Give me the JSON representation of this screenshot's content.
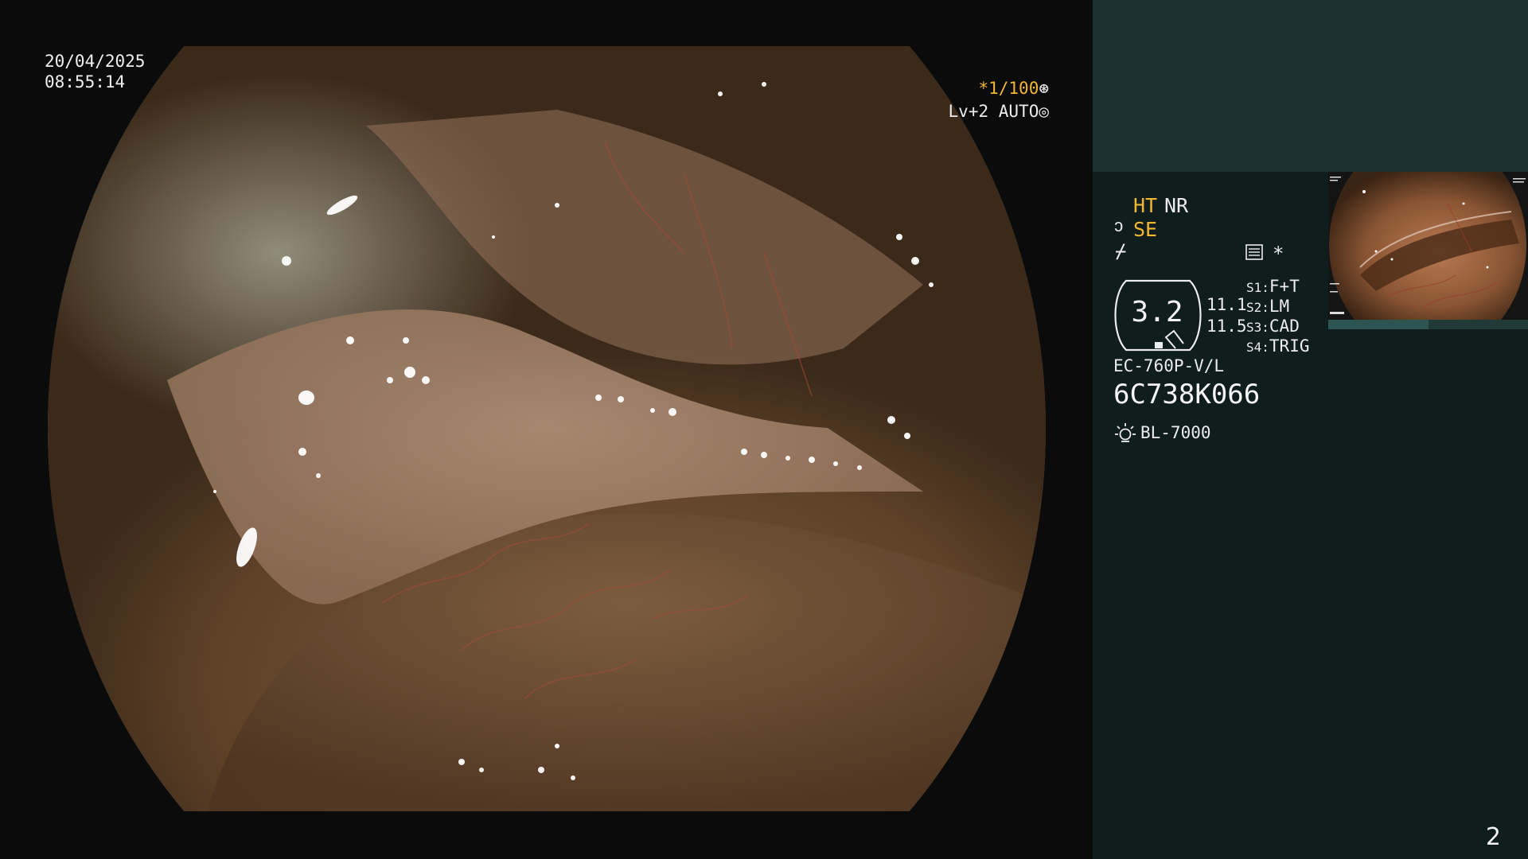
{
  "main_view": {
    "date": "20/04/2025",
    "time": "08:55:14",
    "shutter_speed": "*1/100",
    "shutter_icon": "shutter-icon",
    "enhancement_level": "Lv+2",
    "iris_mode": "AUTO",
    "iris_icon": "iris-icon"
  },
  "panel": {
    "ht_label": "HT",
    "nr_label": "NR",
    "se_icon_glyph": "ↄ",
    "se_label": "SE",
    "aux_icon_glyph": "⌿",
    "menu_icon": "menu-list-icon",
    "star_label": "*",
    "gauge_value": "3.2",
    "sub_value_1": "11.1",
    "sub_value_2": "11.5",
    "slots": [
      {
        "key": "S1:",
        "value": "F+T"
      },
      {
        "key": "S2:",
        "value": "LM"
      },
      {
        "key": "S3:",
        "value": "CAD"
      },
      {
        "key": "S4:",
        "value": "TRIG"
      }
    ],
    "scope_model": "EC-760P-V/L",
    "scope_serial": "6C738K066",
    "light_icon": "light-source-icon",
    "light_source": "BL-7000"
  },
  "page_number": "2",
  "colors": {
    "accent_yellow": "#f1b634",
    "panel_bg": "#0f1d1c",
    "panel_top": "#1a3230",
    "text": "#ececec"
  }
}
